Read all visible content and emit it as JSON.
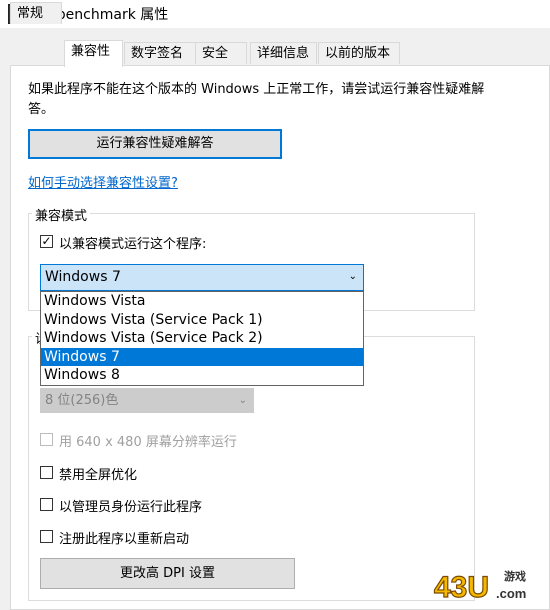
{
  "window": {
    "title": "b1_benchmark 属性"
  },
  "tabs": [
    {
      "label": "常规"
    },
    {
      "label": "兼容性"
    },
    {
      "label": "数字签名"
    },
    {
      "label": "安全"
    },
    {
      "label": "详细信息"
    },
    {
      "label": "以前的版本"
    }
  ],
  "active_tab": "兼容性",
  "intro_text": "如果此程序不能在这个版本的 Windows 上正常工作，请尝试运行兼容性疑难解答。",
  "run_troubleshooter_label": "运行兼容性疑难解答",
  "manual_link_text": "如何手动选择兼容性设置?",
  "compat_mode": {
    "group_label": "兼容模式",
    "checkbox_label": "以兼容模式运行这个程序:",
    "checked": true,
    "selected_value": "Windows 7",
    "options": [
      "Windows Vista",
      "Windows Vista (Service Pack 1)",
      "Windows Vista (Service Pack 2)",
      "Windows 7",
      "Windows 8"
    ],
    "selected_index": 3
  },
  "settings": {
    "group_label_partial": "设",
    "color_select_value": "8 位(256)色",
    "run_640_label": "用 640 x 480 屏幕分辨率运行",
    "disable_fullscreen_label": "禁用全屏优化",
    "run_as_admin_label": "以管理员身份运行此程序",
    "register_restart_label": "注册此程序以重新启动",
    "dpi_button_label": "更改高 DPI 设置"
  },
  "watermark": {
    "text": "43U",
    "sub": "游戏",
    "domain": ".com"
  }
}
